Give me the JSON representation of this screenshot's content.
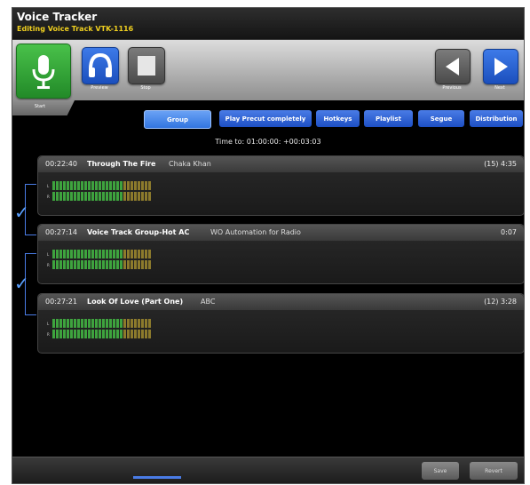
{
  "window": {
    "title": "Voice Tracker",
    "subtitle": "Editing Voice Track VTK-1116"
  },
  "toolbar": {
    "start_label": "Start",
    "preview_label": "Preview",
    "stop_label": "Stop",
    "previous_label": "Previous",
    "next_label": "Next",
    "icons": {
      "start": "microphone-icon",
      "preview": "headphones-icon",
      "stop": "stop-icon",
      "previous": "triangle-left-icon",
      "next": "triangle-right-icon"
    }
  },
  "tabs": [
    {
      "label": "Group",
      "active": true
    },
    {
      "label": "Play Precut completely",
      "active": false
    },
    {
      "label": "Hotkeys",
      "active": false
    },
    {
      "label": "Playlist",
      "active": false
    },
    {
      "label": "Segue",
      "active": false
    },
    {
      "label": "Distribution",
      "active": false
    }
  ],
  "time_to": "Time to: 01:00:00: +00:03:03",
  "tracks": [
    {
      "time": "00:22:40",
      "title": "Through The Fire",
      "artist": "Chaka Khan",
      "length": "(15) 4:35",
      "meter_l_label": "L",
      "meter_r_label": "R",
      "checked": true
    },
    {
      "time": "00:27:14",
      "title": "Voice Track Group-Hot AC",
      "artist": "WO Automation for Radio",
      "length": "0:07",
      "meter_l_label": "L",
      "meter_r_label": "R",
      "checked": true
    },
    {
      "time": "00:27:21",
      "title": "Look Of Love (Part One)",
      "artist": "ABC",
      "length": "(12) 3:28",
      "meter_l_label": "L",
      "meter_r_label": "R",
      "checked": false
    }
  ],
  "footer": {
    "save_label": "Save",
    "revert_label": "Revert"
  },
  "colors": {
    "accent_blue": "#2f63d6",
    "start_green": "#3aa53a",
    "subtitle_yellow": "#f0d020",
    "meter_green": "#3ea33e",
    "meter_amber": "#8c7a2c"
  }
}
